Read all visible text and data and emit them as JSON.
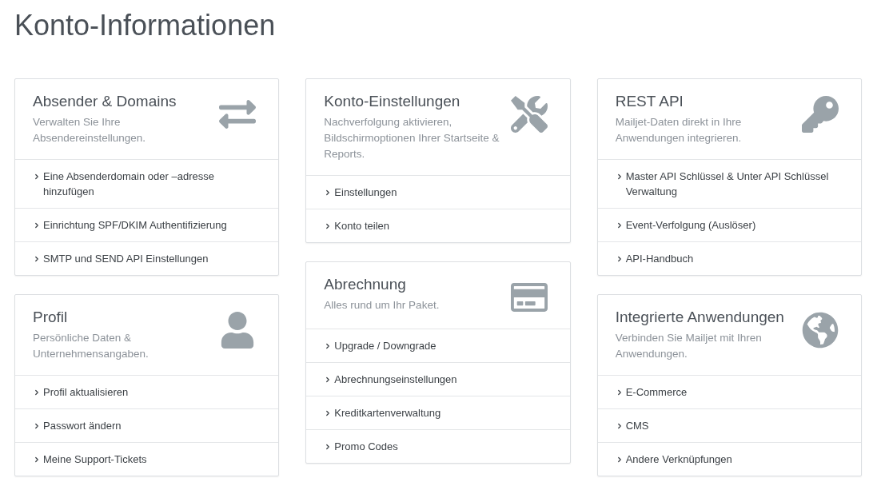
{
  "page_title": "Konto-Informationen",
  "columns": [
    [
      {
        "title": "Absender & Domains",
        "description": "Verwalten Sie Ihre Absendereinstellungen.",
        "kind": "arrows",
        "links": [
          "Eine Absenderdomain oder –adresse hinzufügen",
          "Einrichtung SPF/DKIM Authentifizierung",
          "SMTP und SEND API Einstellungen"
        ]
      },
      {
        "title": "Profil",
        "description": "Persönliche Daten & Unternehmensangaben.",
        "kind": "user",
        "links": [
          "Profil aktualisieren",
          "Passwort ändern",
          "Meine Support-Tickets"
        ]
      }
    ],
    [
      {
        "title": "Konto-Einstellungen",
        "description": "Nachverfolgung aktivieren, Bildschirmoptionen Ihrer Startseite & Reports.",
        "kind": "tools",
        "links": [
          "Einstellungen",
          "Konto teilen"
        ]
      },
      {
        "title": "Abrechnung",
        "description": "Alles rund um Ihr Paket.",
        "kind": "card",
        "links": [
          "Upgrade / Downgrade",
          "Abrechnungseinstellungen",
          "Kreditkartenverwaltung",
          "Promo Codes"
        ]
      }
    ],
    [
      {
        "title": "REST API",
        "description": "Mailjet-Daten direkt in Ihre Anwendungen integrieren.",
        "kind": "key",
        "links": [
          "Master API Schlüssel & Unter API Schlüssel Verwaltung",
          "Event-Verfolgung (Auslöser)",
          "API-Handbuch"
        ]
      },
      {
        "title": "Integrierte Anwendungen",
        "description": "Verbinden Sie Mailjet mit Ihren Anwendungen.",
        "kind": "globe",
        "links": [
          "E-Commerce",
          "CMS",
          "Andere Verknüpfungen"
        ]
      }
    ]
  ]
}
